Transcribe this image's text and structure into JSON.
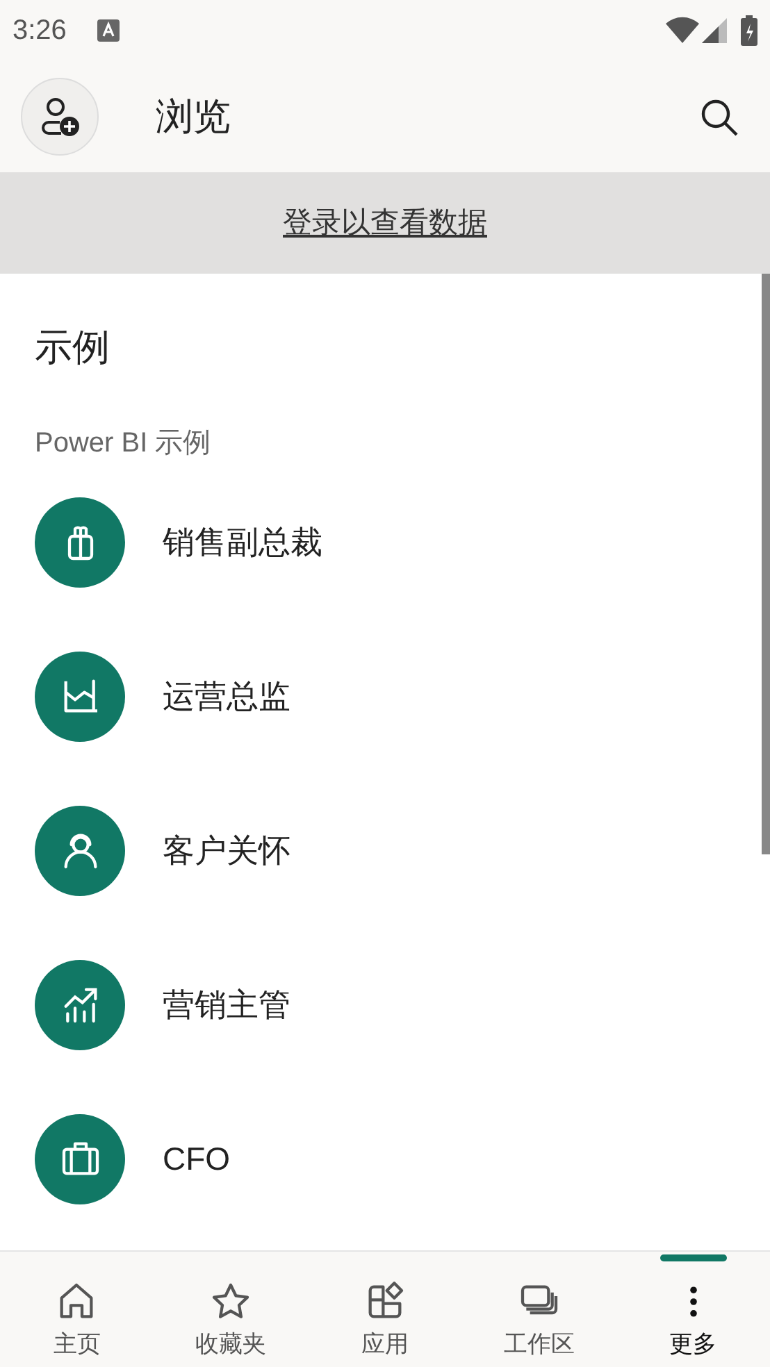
{
  "status_bar": {
    "time": "3:26"
  },
  "header": {
    "title": "浏览"
  },
  "banner": {
    "link": "登录以查看数据"
  },
  "section": {
    "title": "示例",
    "subtitle": "Power BI 示例"
  },
  "samples": [
    {
      "label": "销售副总裁"
    },
    {
      "label": "运营总监"
    },
    {
      "label": "客户关怀"
    },
    {
      "label": "营销主管"
    },
    {
      "label": "CFO"
    }
  ],
  "nav": [
    {
      "label": "主页",
      "selected": false
    },
    {
      "label": "收藏夹",
      "selected": false
    },
    {
      "label": "应用",
      "selected": false
    },
    {
      "label": "工作区",
      "selected": false
    },
    {
      "label": "更多",
      "selected": true
    }
  ]
}
